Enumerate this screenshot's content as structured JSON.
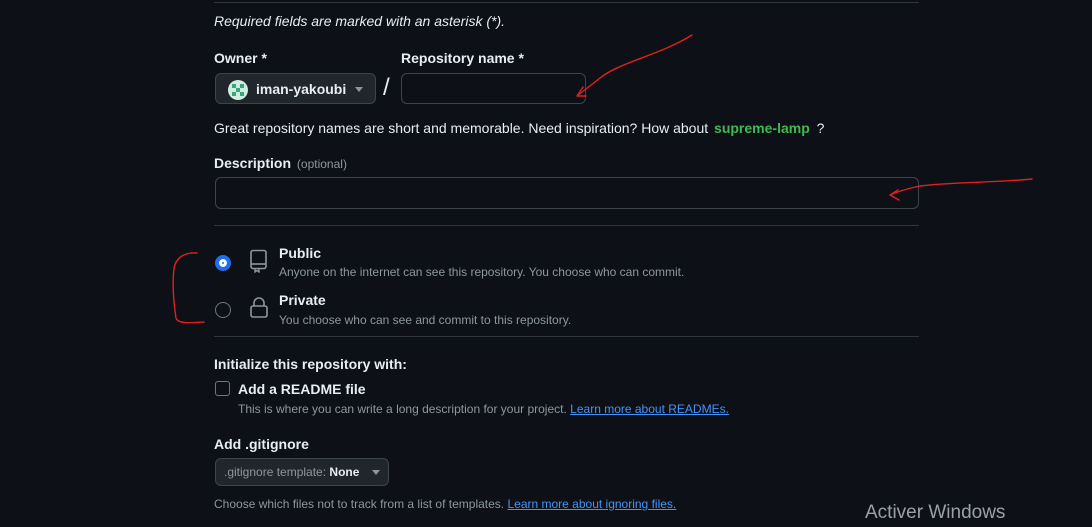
{
  "form": {
    "required_note": "Required fields are marked with an asterisk (*).",
    "owner_label": "Owner *",
    "owner_value": "iman-yakoubi",
    "separator": "/",
    "repo_label": "Repository name *",
    "repo_value": "",
    "suggestion_prefix": "Great repository names are short and memorable. Need inspiration? How about",
    "suggestion_name": "supreme-lamp",
    "suggestion_suffix": "?",
    "description_label": "Description",
    "description_optional": "(optional)",
    "description_value": ""
  },
  "visibility": {
    "selected": "public",
    "options": [
      {
        "title": "Public",
        "desc": "Anyone on the internet can see this repository. You choose who can commit."
      },
      {
        "title": "Private",
        "desc": "You choose who can see and commit to this repository."
      }
    ]
  },
  "initialize": {
    "heading": "Initialize this repository with:",
    "readme_label": "Add a README file",
    "readme_desc": "This is where you can write a long description for your project.",
    "readme_link": "Learn more about READMEs.",
    "readme_checked": false
  },
  "gitignore": {
    "heading": "Add .gitignore",
    "select_prefix": ".gitignore template:",
    "select_value": "None",
    "desc": "Choose which files not to track from a list of templates.",
    "link": "Learn more about ignoring files."
  },
  "watermark": "Activer Windows",
  "colors": {
    "background": "#0d1117",
    "accent_green": "#3fb950",
    "link_blue": "#4493f8",
    "annotation_red": "#e0201d"
  },
  "icons": {
    "owner_avatar": "identicon-avatar",
    "public": "repo-book-icon",
    "private": "lock-icon"
  }
}
